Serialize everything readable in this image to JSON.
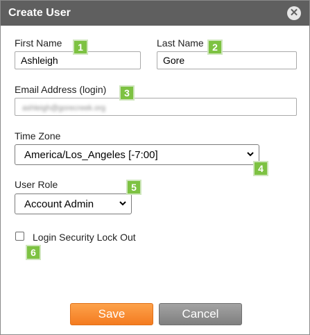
{
  "dialog": {
    "title": "Create User",
    "close_icon": "close-icon"
  },
  "form": {
    "first_name": {
      "label": "First Name",
      "value": "Ashleigh"
    },
    "last_name": {
      "label": "Last Name",
      "value": "Gore"
    },
    "email": {
      "label": "Email Address (login)",
      "value": "ashleigh@gorecreek.org"
    },
    "time_zone": {
      "label": "Time Zone",
      "value": "America/Los_Angeles [-7:00]"
    },
    "user_role": {
      "label": "User Role",
      "value": "Account Admin"
    },
    "lockout": {
      "label": "Login Security Lock Out",
      "checked": false
    }
  },
  "callouts": [
    "1",
    "2",
    "3",
    "4",
    "5",
    "6"
  ],
  "buttons": {
    "save": "Save",
    "cancel": "Cancel"
  },
  "colors": {
    "titlebar": "#5f5f5f",
    "callout": "#7dc242",
    "save": "#f47b20",
    "cancel": "#8a8a8a"
  }
}
